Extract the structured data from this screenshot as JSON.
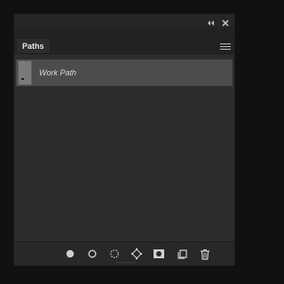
{
  "panel": {
    "tab_label": "Paths",
    "colors": {
      "background": "#2c2c2c",
      "tab_bar": "#222222",
      "selected_row": "#4c4c4c",
      "icon": "#d0d0d0"
    }
  },
  "paths": [
    {
      "name": "Work Path",
      "selected": true
    }
  ],
  "footer_icons": [
    "fill-path-icon",
    "stroke-path-icon",
    "load-selection-icon",
    "make-work-path-icon",
    "add-mask-icon",
    "new-path-icon",
    "trash-icon"
  ]
}
